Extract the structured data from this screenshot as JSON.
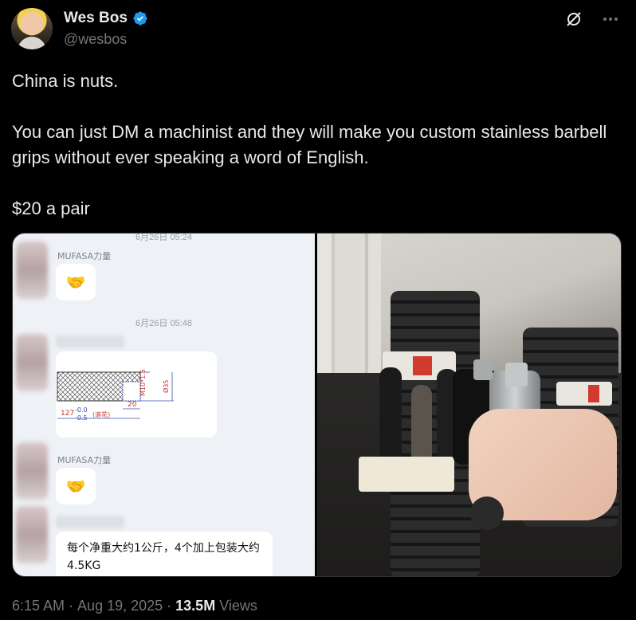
{
  "author": {
    "display_name": "Wes Bos",
    "handle": "@wesbos",
    "verified_icon": "verified-badge-icon",
    "badge_color": "#1d9bf0"
  },
  "tweet": {
    "lines": [
      "China is nuts.",
      "You can just DM a machinist and they will make you custom stainless barbell grips without ever speaking a word of English.",
      "$20 a pair"
    ]
  },
  "chat": {
    "time_top": "6月26日 05:24",
    "name_1": "MUFASA力量",
    "emoji_1": "🤝",
    "time_mid": "6月26日 05:48",
    "drawing": {
      "dim_top": "M10*1.5",
      "dim_right": "Ø35",
      "dim_len": "20",
      "dim_total": "127",
      "tol_plus": "-0.0",
      "tol_minus": "-0.5",
      "note": "(滚花)"
    },
    "name_2": "MUFASA力量",
    "emoji_2": "🤝",
    "message": "每个净重大约1公斤，4个加上包装大约4.5KG"
  },
  "footer": {
    "time": "6:15 AM",
    "separator": "·",
    "date": "Aug 19, 2025",
    "views_count": "13.5M",
    "views_label": "Views"
  },
  "colors": {
    "background": "#000000",
    "text": "#e7e9ea",
    "muted": "#71767b",
    "accent": "#1d9bf0"
  }
}
